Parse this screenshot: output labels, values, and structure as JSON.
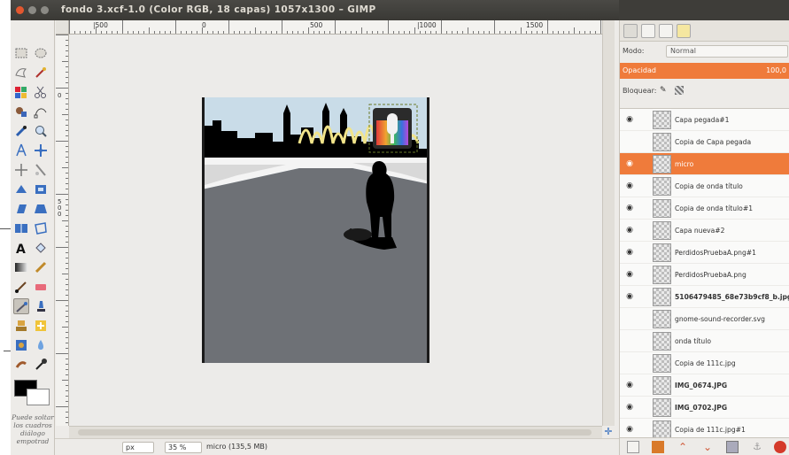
{
  "window": {
    "title": "fondo 3.xcf-1.0 (Color RGB, 18 capas) 1057x1300 – GIMP"
  },
  "toolbox": {
    "hint": "Puede soltar\nlos cuadros\ndiálogo\nempotrad"
  },
  "ruler": {
    "h_labels": [
      "|500",
      "0",
      "500",
      "|1000",
      "1500"
    ],
    "v_labels": [
      "0",
      "500"
    ]
  },
  "statusbar": {
    "unit": "px",
    "zoom": "35 %",
    "layer_info": "micro (135,5 MB)"
  },
  "layers_panel": {
    "mode_label": "Modo:",
    "mode_value": "Normal",
    "opacity_label": "Opacidad",
    "opacity_value": "100,0",
    "lock_label": "Bloquear:",
    "layers": [
      {
        "name": "Capa pegada#1",
        "visible": true,
        "selected": false,
        "bold": false
      },
      {
        "name": "Copia de Capa pegada",
        "visible": false,
        "selected": false,
        "bold": false
      },
      {
        "name": "micro",
        "visible": true,
        "selected": true,
        "bold": false
      },
      {
        "name": "Copia de onda título",
        "visible": true,
        "selected": false,
        "bold": false
      },
      {
        "name": "Copia de onda título#1",
        "visible": true,
        "selected": false,
        "bold": false
      },
      {
        "name": "Capa nueva#2",
        "visible": true,
        "selected": false,
        "bold": false
      },
      {
        "name": "PerdidosPruebaA.png#1",
        "visible": true,
        "selected": false,
        "bold": false
      },
      {
        "name": "PerdidosPruebaA.png",
        "visible": true,
        "selected": false,
        "bold": false
      },
      {
        "name": "5106479485_68e73b9cf8_b.jpg",
        "visible": true,
        "selected": false,
        "bold": true
      },
      {
        "name": "gnome-sound-recorder.svg",
        "visible": false,
        "selected": false,
        "bold": false
      },
      {
        "name": "onda título",
        "visible": false,
        "selected": false,
        "bold": false
      },
      {
        "name": "Copia de 111c.jpg",
        "visible": false,
        "selected": false,
        "bold": false
      },
      {
        "name": "IMG_0674.JPG",
        "visible": true,
        "selected": false,
        "bold": true
      },
      {
        "name": "IMG_0702.JPG",
        "visible": true,
        "selected": false,
        "bold": true
      },
      {
        "name": "Copia de 111c.jpg#1",
        "visible": true,
        "selected": false,
        "bold": false
      }
    ]
  },
  "colors": {
    "accent": "#ef7b3b",
    "titlebar": "#3f3e3a",
    "road": "#6e7176",
    "sky": "#c9dce8"
  }
}
